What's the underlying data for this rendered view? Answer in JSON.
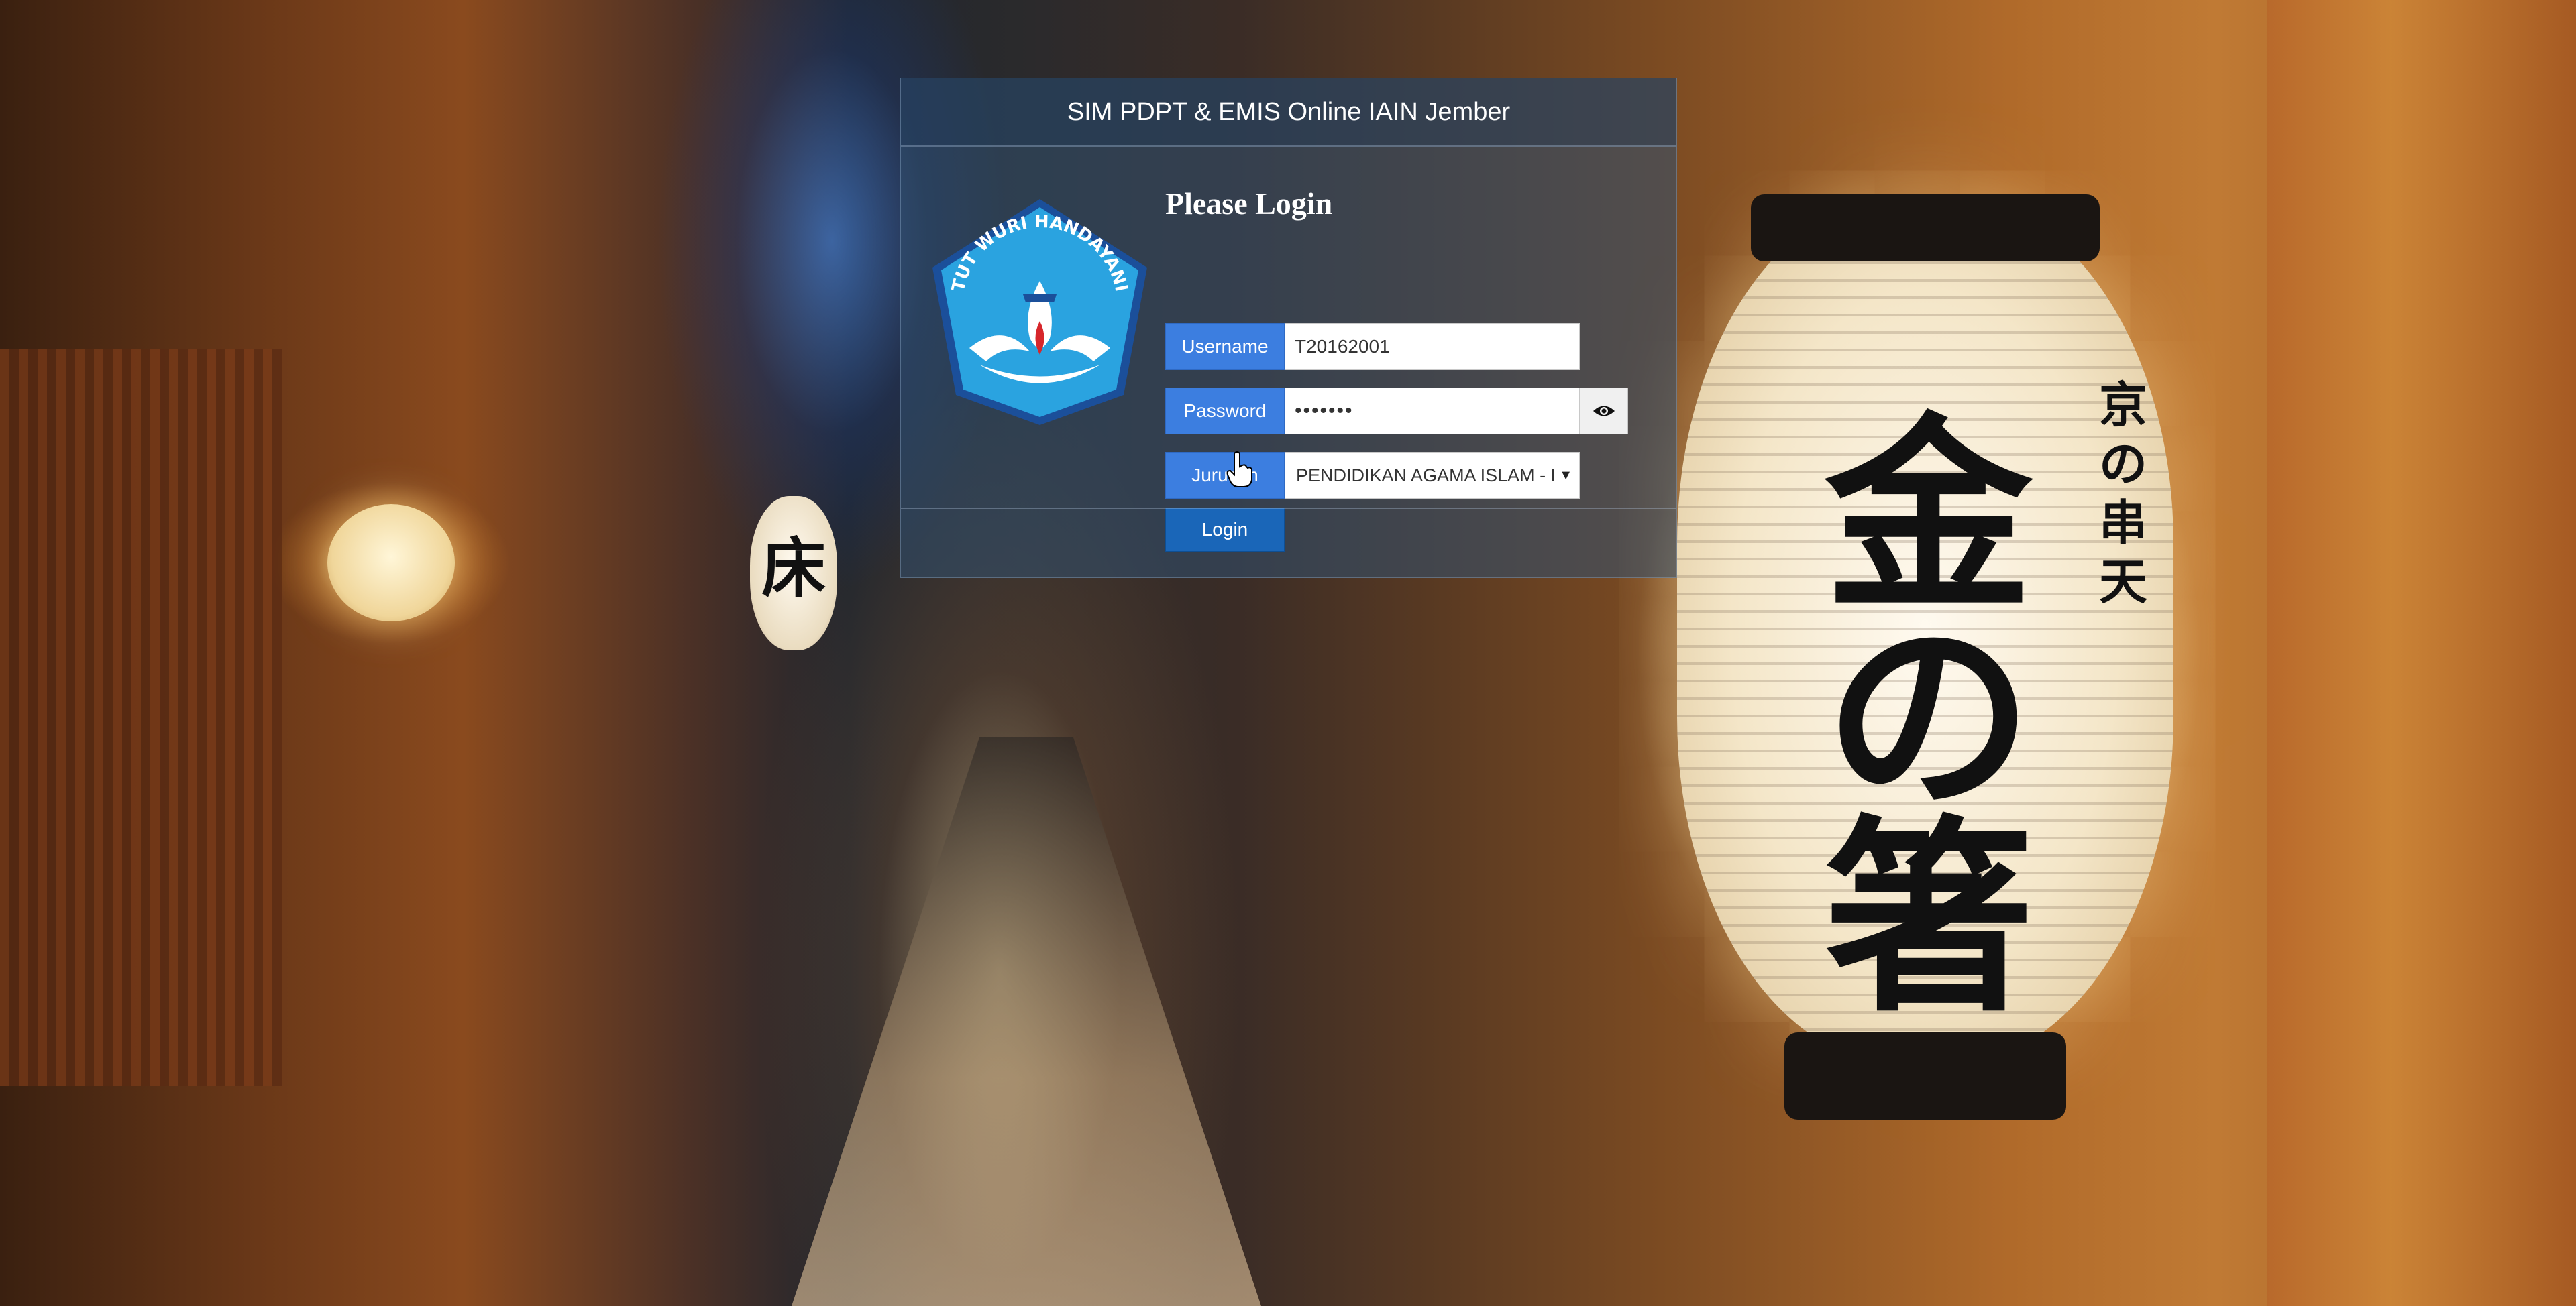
{
  "app": {
    "title": "SIM PDPT & EMIS Online IAIN Jember"
  },
  "logo": {
    "arc_text": "TUT WURI HANDAYANI",
    "icon": "tut-wuri-handayani-logo"
  },
  "login": {
    "heading": "Please Login",
    "username": {
      "label": "Username",
      "value": "T20162001"
    },
    "password": {
      "label": "Password",
      "masked_value": "•••••••",
      "toggle_icon": "eye-icon"
    },
    "jurusan": {
      "label": "Jurusan",
      "selected": "PENDIDIKAN AGAMA ISLAM - PAI"
    },
    "submit_label": "Login"
  },
  "background": {
    "lantern_large_text": "金の箸",
    "lantern_large_side_text": "京の串天",
    "lantern_mid_text": "床"
  },
  "colors": {
    "addon_blue": "#3c7ee0",
    "button_blue": "#1a66b8",
    "panel_bg": "rgba(50,80,112,0.55)"
  }
}
